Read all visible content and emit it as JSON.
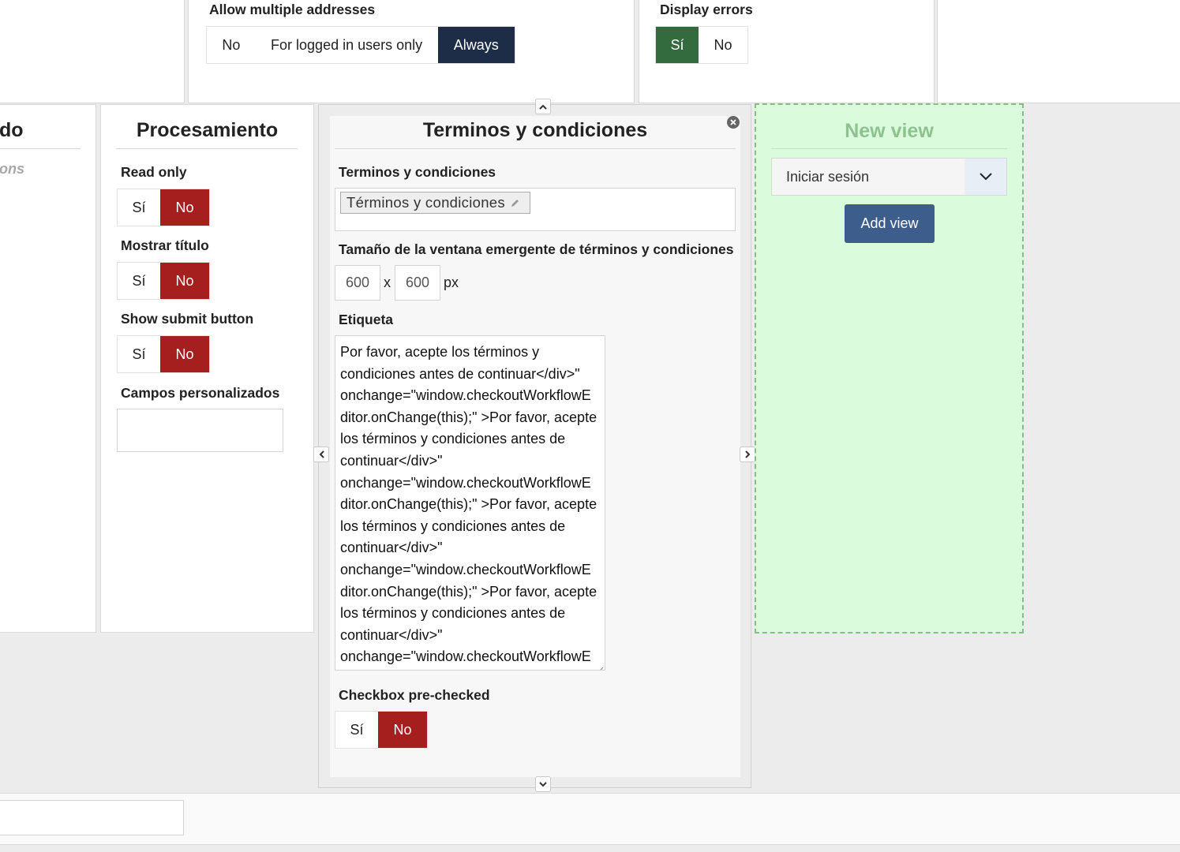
{
  "top": {
    "allow_multiple": {
      "label": "Allow multiple addresses",
      "options": [
        "No",
        "For logged in users only",
        "Always"
      ]
    },
    "display_errors": {
      "label": "Display errors",
      "options": [
        "Sí",
        "No"
      ]
    }
  },
  "left_fragment": {
    "title": "do",
    "subtitle": "ons"
  },
  "processing": {
    "title": "Procesamiento",
    "read_only": {
      "label": "Read only",
      "options": [
        "Sí",
        "No"
      ]
    },
    "show_title": {
      "label": "Mostrar título",
      "options": [
        "Sí",
        "No"
      ]
    },
    "show_submit": {
      "label": "Show submit button",
      "options": [
        "Sí",
        "No"
      ]
    },
    "custom_fields": {
      "label": "Campos personalizados"
    }
  },
  "terms": {
    "title": "Terminos y condiciones",
    "terms_label": "Terminos y condiciones",
    "terms_tag": "Términos y condiciones",
    "popup_size_label": "Tamaño de la ventana emergente de términos y condiciones",
    "width": "600",
    "height": "600",
    "times": "x",
    "unit": "px",
    "etiqueta_label": "Etiqueta",
    "etiqueta_lines": [
      "Por favor, acepte los términos y",
      "condiciones antes de continuar</div>\"",
      "onchange=\"window.checkoutWorkflowE",
      "ditor.onChange(this);\" >Por favor, acepte",
      "los términos y condiciones antes de",
      "continuar</div>\"",
      "onchange=\"window.checkoutWorkflowE",
      "ditor.onChange(this);\" >Por favor, acepte",
      "los términos y condiciones antes de",
      "continuar</div>\"",
      "onchange=\"window.checkoutWorkflowE",
      "ditor.onChange(this);\" >Por favor, acepte",
      "los términos y condiciones antes de",
      "continuar</div>\"",
      "onchange=\"window.checkoutWorkflowE"
    ],
    "prechecked": {
      "label": "Checkbox pre-checked",
      "options": [
        "Sí",
        "No"
      ]
    }
  },
  "new_view": {
    "title": "New view",
    "select_value": "Iniciar sesión",
    "add_label": "Add view"
  },
  "colors": {
    "active_red": "#a51f1f",
    "active_green": "#336b3f",
    "active_navy": "#1d2c47",
    "new_view_bg": "#dbfcdc",
    "new_view_title": "#8ec38f",
    "add_button": "#3d5d8c"
  }
}
